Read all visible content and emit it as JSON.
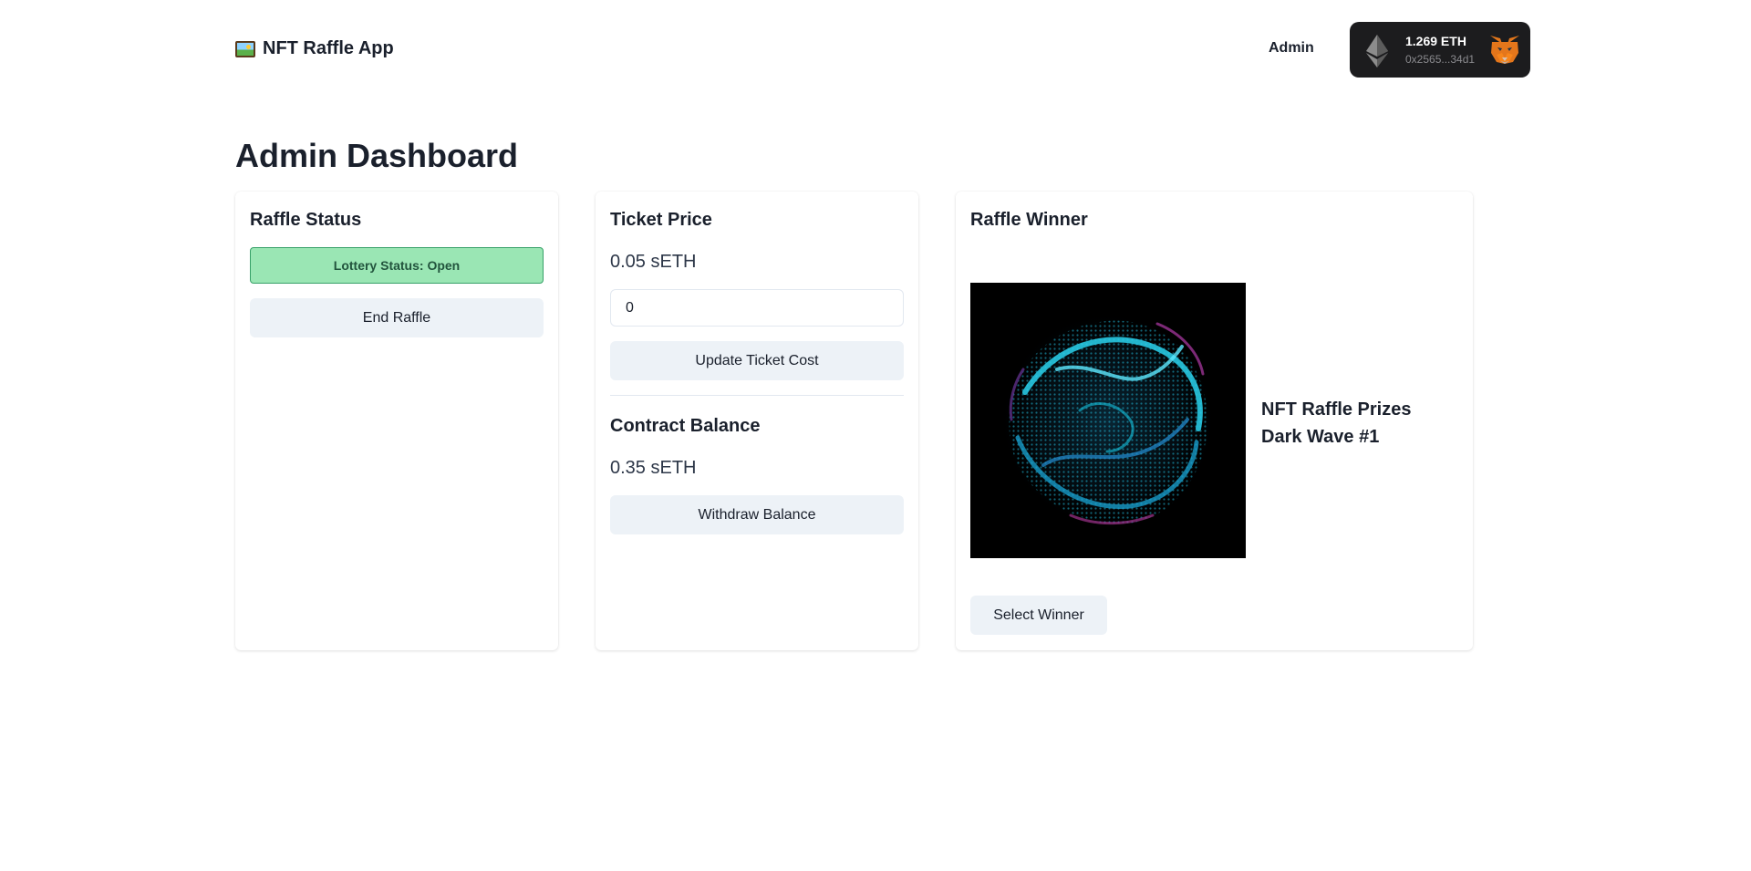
{
  "app": {
    "title": "NFT Raffle App",
    "brand_icon": "framed-picture-icon"
  },
  "nav": {
    "admin_label": "Admin"
  },
  "wallet": {
    "balance": "1.269 ETH",
    "address": "0x2565...34d1",
    "chain_icon": "ethereum-icon",
    "provider_icon": "metamask-fox-icon"
  },
  "page": {
    "title": "Admin Dashboard"
  },
  "raffle_status": {
    "heading": "Raffle Status",
    "status_text": "Lottery Status: Open",
    "status_color": "#9ae6b4",
    "end_button": "End Raffle"
  },
  "ticket_price": {
    "heading": "Ticket Price",
    "value": "0.05 sETH",
    "input_value": "0",
    "update_button": "Update Ticket Cost"
  },
  "contract_balance": {
    "heading": "Contract Balance",
    "value": "0.35 sETH",
    "withdraw_button": "Withdraw Balance"
  },
  "raffle_winner": {
    "heading": "Raffle Winner",
    "nft_collection": "NFT Raffle Prizes",
    "nft_name": "Dark Wave #1",
    "select_button": "Select Winner"
  }
}
